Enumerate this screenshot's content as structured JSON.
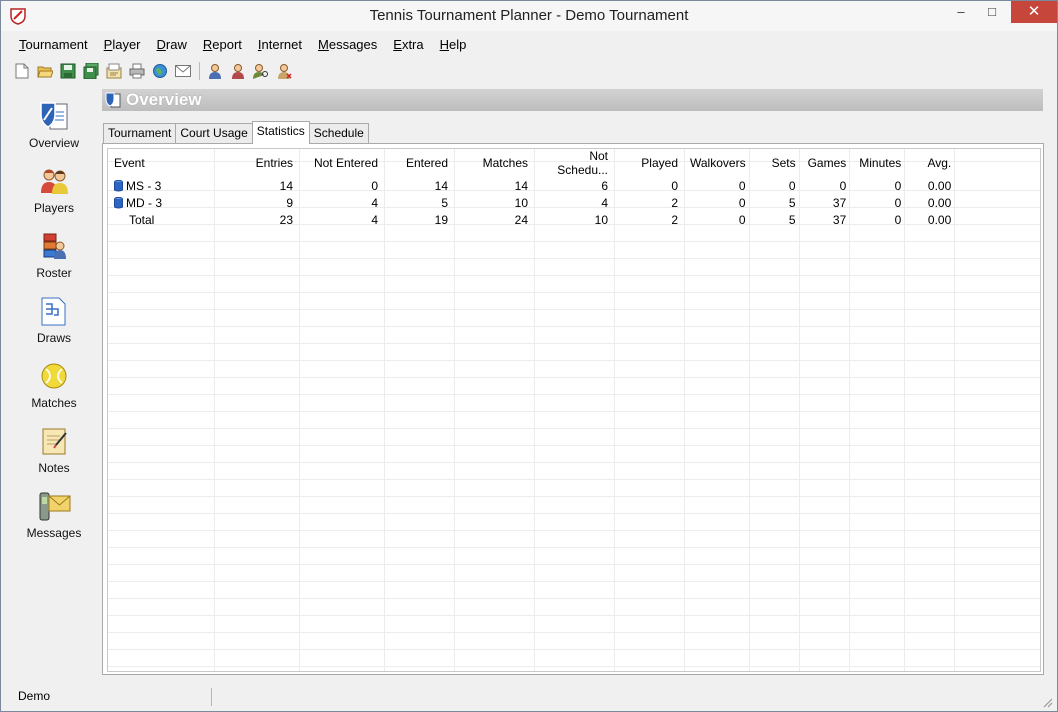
{
  "window": {
    "title": "Tennis Tournament Planner - Demo Tournament",
    "minimize_glyph": "–",
    "maximize_glyph": "□",
    "close_glyph": "✕"
  },
  "menu": {
    "items": [
      {
        "accel": "T",
        "rest": "ournament"
      },
      {
        "accel": "P",
        "rest": "layer"
      },
      {
        "accel": "D",
        "rest": "raw"
      },
      {
        "accel": "R",
        "rest": "eport"
      },
      {
        "accel": "I",
        "rest": "nternet"
      },
      {
        "accel": "M",
        "rest": "essages"
      },
      {
        "accel": "E",
        "rest": "xtra"
      },
      {
        "accel": "H",
        "rest": "elp"
      }
    ]
  },
  "toolbar": {
    "icons": [
      "new-file-icon",
      "open-folder-icon",
      "save-icon",
      "save-all-icon",
      "properties-icon",
      "print-icon",
      "web-icon",
      "email-icon",
      "player-add-icon",
      "player-edit-icon",
      "player-search-icon",
      "player-delete-icon"
    ]
  },
  "sidebar": {
    "items": [
      {
        "label": "Overview",
        "icon": "overview-icon"
      },
      {
        "label": "Players",
        "icon": "players-icon"
      },
      {
        "label": "Roster",
        "icon": "roster-icon"
      },
      {
        "label": "Draws",
        "icon": "draws-icon"
      },
      {
        "label": "Matches",
        "icon": "matches-icon"
      },
      {
        "label": "Notes",
        "icon": "notes-icon"
      },
      {
        "label": "Messages",
        "icon": "messages-icon"
      }
    ]
  },
  "header": {
    "title": "Overview"
  },
  "tabs": [
    {
      "label": "Tournament",
      "active": false
    },
    {
      "label": "Court Usage",
      "active": false
    },
    {
      "label": "Statistics",
      "active": true
    },
    {
      "label": "Schedule",
      "active": false
    }
  ],
  "table": {
    "columns": [
      "Event",
      "Entries",
      "Not Entered",
      "Entered",
      "Matches",
      "Not Schedu...",
      "Played",
      "Walkovers",
      "Sets",
      "Games",
      "Minutes",
      "Avg."
    ],
    "rows": [
      {
        "event": "MS - 3",
        "cells": [
          "14",
          "0",
          "14",
          "14",
          "6",
          "0",
          "0",
          "0",
          "0",
          "0",
          "0.00"
        ]
      },
      {
        "event": "MD - 3",
        "cells": [
          "9",
          "4",
          "5",
          "10",
          "4",
          "2",
          "0",
          "5",
          "37",
          "0",
          "0.00"
        ]
      },
      {
        "event": "Total",
        "cells": [
          "23",
          "4",
          "19",
          "24",
          "10",
          "2",
          "0",
          "5",
          "37",
          "0",
          "0.00"
        ]
      }
    ]
  },
  "status": {
    "text": "Demo"
  },
  "colors": {
    "header_bar": "#c8c8c8",
    "close_button": "#c7463c",
    "grid_line": "#ececec"
  }
}
